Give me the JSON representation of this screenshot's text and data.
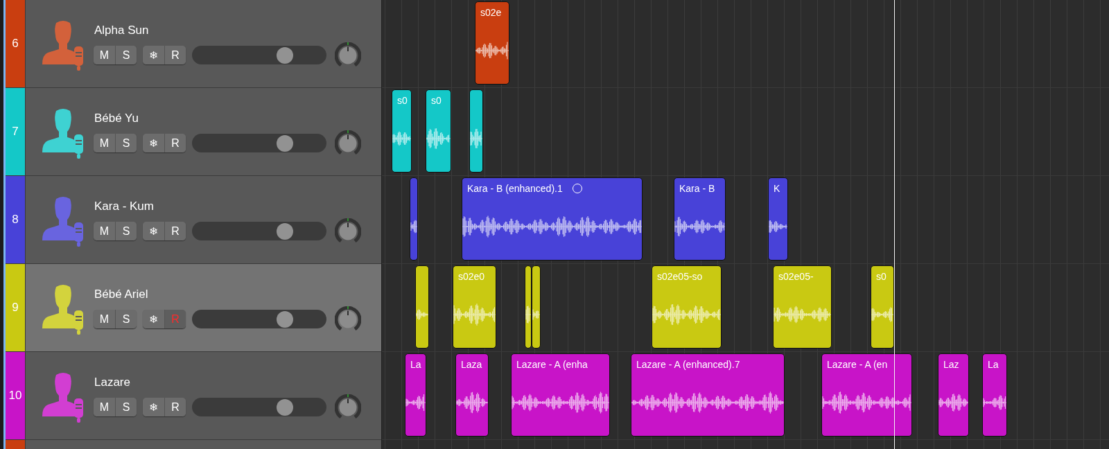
{
  "tracks": [
    {
      "number": "6",
      "name": "Alpha Sun",
      "color": "#c93e10",
      "selected": false,
      "level": 0.72,
      "buttons": [
        {
          "label": "M",
          "kind": "mute",
          "on": false
        },
        {
          "label": "S",
          "kind": "solo",
          "on": false
        },
        {
          "label": "❄",
          "kind": "freeze",
          "on": false
        },
        {
          "label": "R",
          "kind": "record",
          "on": false
        }
      ],
      "regions": [
        {
          "label": "s02e",
          "circle_marker": false
        }
      ]
    },
    {
      "number": "7",
      "name": "Bébé Yu",
      "color": "#14c8c8",
      "selected": false,
      "level": 0.72,
      "buttons": [
        {
          "label": "M",
          "kind": "mute",
          "on": false
        },
        {
          "label": "S",
          "kind": "solo",
          "on": false
        },
        {
          "label": "❄",
          "kind": "freeze",
          "on": false
        },
        {
          "label": "R",
          "kind": "record",
          "on": false
        }
      ],
      "regions": [
        {
          "label": "s0",
          "circle_marker": false
        },
        {
          "label": "s0",
          "circle_marker": false
        },
        {
          "circle_marker": false
        }
      ]
    },
    {
      "number": "8",
      "name": "Kara - Kum",
      "color": "#4842d8",
      "selected": false,
      "level": 0.72,
      "buttons": [
        {
          "label": "M",
          "kind": "mute",
          "on": false
        },
        {
          "label": "S",
          "kind": "solo",
          "on": false
        },
        {
          "label": "❄",
          "kind": "freeze",
          "on": false
        },
        {
          "label": "R",
          "kind": "record",
          "on": false
        }
      ],
      "regions": [
        {
          "circle_marker": false
        },
        {
          "label": "Kara - B (enhanced).1",
          "circle_marker": true
        },
        {
          "label": "Kara - B",
          "circle_marker": false
        },
        {
          "label": "K",
          "circle_marker": false
        }
      ]
    },
    {
      "number": "9",
      "name": "Bébé Ariel",
      "color": "#c9c912",
      "selected": true,
      "level": 0.72,
      "buttons": [
        {
          "label": "M",
          "kind": "mute",
          "on": false
        },
        {
          "label": "S",
          "kind": "solo",
          "on": false
        },
        {
          "label": "❄",
          "kind": "freeze",
          "on": false
        },
        {
          "label": "R",
          "kind": "record",
          "on": true
        }
      ],
      "regions": [
        {
          "circle_marker": false
        },
        {
          "label": "s02e0",
          "circle_marker": false
        },
        {
          "circle_marker": false
        },
        {
          "circle_marker": false
        },
        {
          "label": "s02e05-so",
          "circle_marker": false
        },
        {
          "label": "s02e05-",
          "circle_marker": false
        },
        {
          "label": "s0",
          "circle_marker": false
        }
      ]
    },
    {
      "number": "10",
      "name": "Lazare",
      "color": "#c814c8",
      "selected": false,
      "level": 0.72,
      "buttons": [
        {
          "label": "M",
          "kind": "mute",
          "on": false
        },
        {
          "label": "S",
          "kind": "solo",
          "on": false
        },
        {
          "label": "❄",
          "kind": "freeze",
          "on": false
        },
        {
          "label": "R",
          "kind": "record",
          "on": false
        }
      ],
      "regions": [
        {
          "label": "La",
          "circle_marker": false
        },
        {
          "label": "Laza",
          "circle_marker": false
        },
        {
          "label": "Lazare - A (enha",
          "circle_marker": false
        },
        {
          "label": "Lazare - A (enhanced).7",
          "circle_marker": false
        },
        {
          "label": "Lazare - A (en",
          "circle_marker": false
        },
        {
          "label": "Laz",
          "circle_marker": false
        },
        {
          "label": "La",
          "circle_marker": false
        }
      ]
    }
  ],
  "next_track": {
    "color": "#c93e10"
  }
}
